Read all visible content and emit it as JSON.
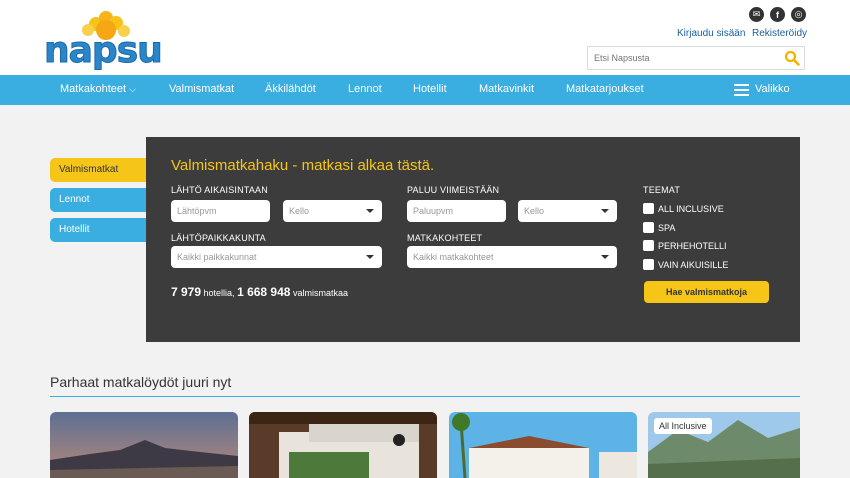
{
  "header": {
    "logo_text": "napsu",
    "social": [
      {
        "icon": "mail-icon",
        "glyph": "✉"
      },
      {
        "icon": "facebook-icon",
        "glyph": "f"
      },
      {
        "icon": "instagram-icon",
        "glyph": "◎"
      }
    ],
    "login_link": "Kirjaudu sisään",
    "register_link": "Rekisteröidy",
    "search_placeholder": "Etsi Napsusta"
  },
  "nav": {
    "items": [
      "Matkakohteet",
      "Valmismatkat",
      "Äkkilähdöt",
      "Lennot",
      "Hotellit",
      "Matkavinkit",
      "Matkatarjoukset"
    ],
    "menu_label": "Valikko"
  },
  "tabs": [
    "Valmismatkat",
    "Lennot",
    "Hotellit"
  ],
  "search_panel": {
    "title": "Valmismatkahaku - matkasi alkaa tästä.",
    "depart_label": "LÄHTÖ AIKAISINTAAN",
    "depart_placeholder": "Lähtöpvm",
    "time_placeholder": "Kello",
    "return_label": "PALUU VIIMEISTÄÄN",
    "return_placeholder": "Paluupvm",
    "origin_label": "LÄHTÖPAIKKAKUNTA",
    "origin_value": "Kaikki paikkakunnat",
    "destination_label": "MATKAKOHTEET",
    "destination_value": "Kaikki matkakohteet",
    "themes_label": "TEEMAT",
    "themes": [
      "ALL INCLUSIVE",
      "SPA",
      "PERHEHOTELLI",
      "VAIN AIKUISILLE"
    ],
    "stats_hotels_count": "7 979",
    "stats_hotels_text": " hotellia, ",
    "stats_trips_count": "1 668 948",
    "stats_trips_text": " valmismatkaa",
    "search_button": "Hae valmismatkoja"
  },
  "deals": {
    "title": "Parhaat matkalöydöt juuri nyt",
    "badge": "All Inclusive"
  },
  "colors": {
    "brand_blue": "#3aaee0",
    "accent_yellow": "#f5c518",
    "panel_dark": "#3c3c3c"
  }
}
